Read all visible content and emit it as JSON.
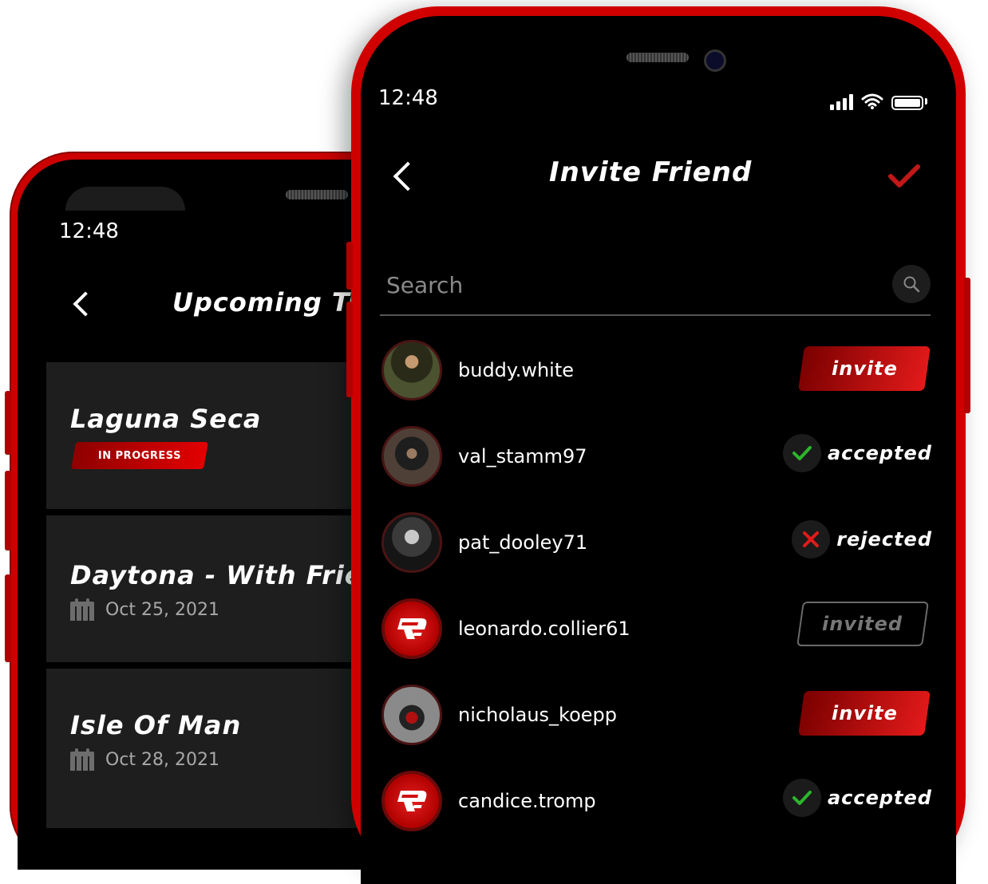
{
  "back_screen": {
    "time": "12:48",
    "title": "Upcoming Tra",
    "tracks": [
      {
        "name": "Laguna Seca",
        "badge": "IN PROGRESS"
      },
      {
        "name": "Daytona - With Frien",
        "date": "Oct 25, 2021"
      },
      {
        "name": "Isle Of Man",
        "date": "Oct 28, 2021"
      }
    ]
  },
  "front_screen": {
    "time": "12:48",
    "title": "Invite Friend",
    "search_placeholder": "Search",
    "friends": [
      {
        "username": "buddy.white",
        "action": "invite"
      },
      {
        "username": "val_stamm97",
        "action": "accepted"
      },
      {
        "username": "pat_dooley71",
        "action": "rejected"
      },
      {
        "username": "leonardo.collier61",
        "action": "invited"
      },
      {
        "username": "nicholaus_koepp",
        "action": "invite"
      },
      {
        "username": "candice.tromp",
        "action": "accepted"
      }
    ]
  },
  "colors": {
    "brand_red": "#d00000",
    "accepted_green": "#2db52d",
    "rejected_red": "#e01b1b"
  }
}
